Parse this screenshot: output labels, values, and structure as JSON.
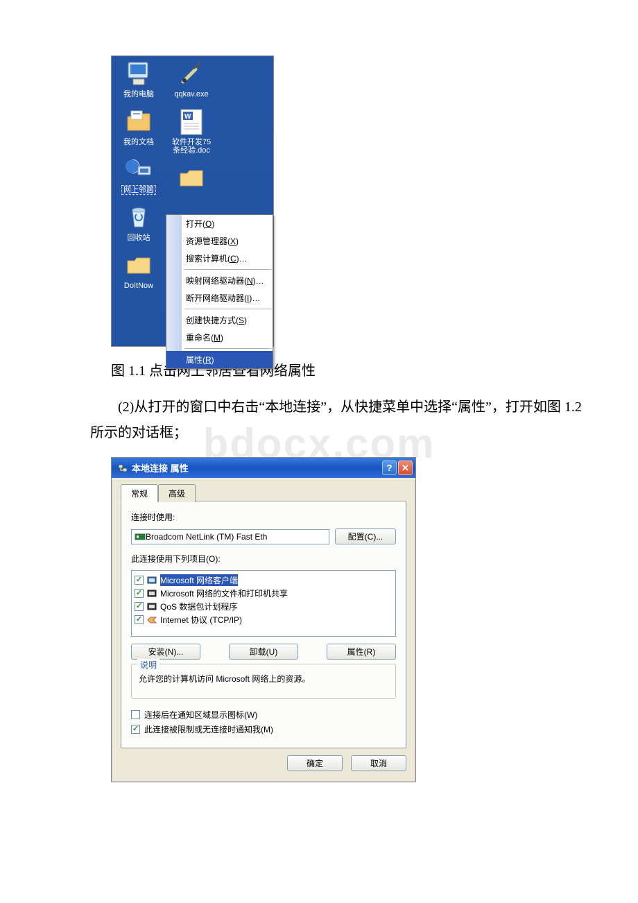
{
  "desktop": {
    "icons_left": [
      {
        "name": "my-computer",
        "label": "我的电脑"
      },
      {
        "name": "my-documents",
        "label": "我的文档"
      },
      {
        "name": "network-neighborhood",
        "label": "网上邻居",
        "selected": true
      },
      {
        "name": "recycle-bin",
        "label": "回收站"
      },
      {
        "name": "do-it-now",
        "label": "DoItNow"
      }
    ],
    "icons_right": [
      {
        "name": "qqkav-exe",
        "label": "qqkav.exe"
      },
      {
        "name": "dev-doc",
        "label": "软件开发75\n条经验.doc"
      },
      {
        "name": "folder1",
        "label": ""
      }
    ],
    "context_menu": {
      "items": [
        {
          "label": "打开(O)",
          "hotkey": "O"
        },
        {
          "label": "资源管理器(X)",
          "hotkey": "X"
        },
        {
          "label": "搜索计算机(C)…",
          "hotkey": "C"
        },
        {
          "sep": true
        },
        {
          "label": "映射网络驱动器(N)…",
          "hotkey": "N"
        },
        {
          "label": "断开网络驱动器(I)…",
          "hotkey": "I"
        },
        {
          "sep": true
        },
        {
          "label": "创建快捷方式(S)",
          "hotkey": "S"
        },
        {
          "label": "重命名(M)",
          "hotkey": "M"
        },
        {
          "sep": true
        },
        {
          "label": "属性(R)",
          "hotkey": "R",
          "highlight": true
        }
      ]
    }
  },
  "caption1": "图 1.1 点击网上邻居查看网络属性",
  "paragraph": "(2)从打开的窗口中右击“本地连接”，从快捷菜单中选择“属性”，打开如图 1.2 所示的对话框；",
  "watermark": "bdocx.com",
  "dialog": {
    "title": "本地连接 属性",
    "tabs": {
      "general": "常规",
      "advanced": "高级",
      "active": "general"
    },
    "connect_using_label": "连接时使用:",
    "adapter_value": "Broadcom NetLink (TM) Fast Eth",
    "configure_btn": "配置(C)...",
    "uses_items_label": "此连接使用下列项目(O):",
    "list_items": [
      {
        "label": "Microsoft 网络客户端",
        "checked": true,
        "selected": true
      },
      {
        "label": "Microsoft 网络的文件和打印机共享",
        "checked": true
      },
      {
        "label": "QoS 数据包计划程序",
        "checked": true
      },
      {
        "label": "Internet 协议 (TCP/IP)",
        "checked": true
      }
    ],
    "install_btn": "安装(N)...",
    "uninstall_btn": "卸载(U)",
    "properties_btn": "属性(R)",
    "group_legend": "说明",
    "group_text": "允许您的计算机访问 Microsoft 网络上的资源。",
    "show_tray": {
      "checked": false,
      "label": "连接后在通知区域显示图标(W)"
    },
    "notify_limited": {
      "checked": true,
      "label": "此连接被限制或无连接时通知我(M)"
    },
    "ok_btn": "确定",
    "cancel_btn": "取消"
  }
}
